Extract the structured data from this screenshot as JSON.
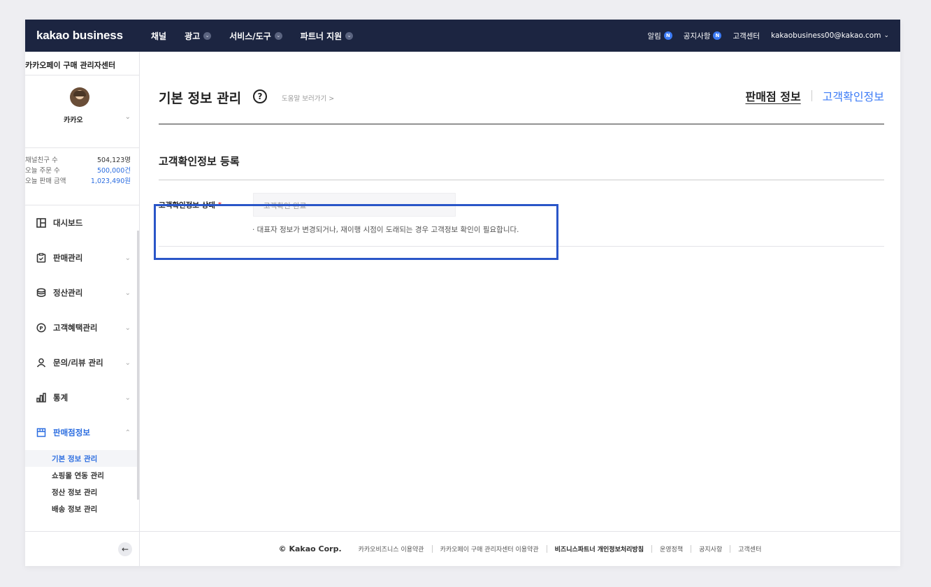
{
  "header": {
    "logo": "kakao business",
    "nav": [
      {
        "label": "채널",
        "dropdown": false
      },
      {
        "label": "광고",
        "dropdown": true
      },
      {
        "label": "서비스/도구",
        "dropdown": true
      },
      {
        "label": "파트너 지원",
        "dropdown": true
      }
    ],
    "alerts_label": "알림",
    "notice_label": "공지사항",
    "badge": "N",
    "support_label": "고객센터",
    "account": "kakaobusiness00@kakao.com"
  },
  "sidebar": {
    "title": "카카오페이 구매 관리자센터",
    "profile_name": "카카오",
    "stats": [
      {
        "label": "채널친구 수",
        "value": "504,123명",
        "highlight": false
      },
      {
        "label": "오늘 주문 수",
        "value": "500,000건",
        "highlight": true
      },
      {
        "label": "오늘 판매 금액",
        "value": "1,023,490원",
        "highlight": true
      }
    ],
    "menu": [
      {
        "label": "대시보드",
        "icon": "dashboard-icon",
        "expandable": false
      },
      {
        "label": "판매관리",
        "icon": "clipboard-icon",
        "expandable": true
      },
      {
        "label": "정산관리",
        "icon": "database-icon",
        "expandable": true
      },
      {
        "label": "고객혜택관리",
        "icon": "point-icon",
        "expandable": true
      },
      {
        "label": "문의/리뷰 관리",
        "icon": "person-icon",
        "expandable": true
      },
      {
        "label": "통계",
        "icon": "bar-chart-icon",
        "expandable": true
      },
      {
        "label": "판매점정보",
        "icon": "store-icon",
        "expandable": true,
        "expanded": true
      }
    ],
    "submenu": [
      {
        "label": "기본 정보 관리",
        "active": true
      },
      {
        "label": "쇼핑몰 연동 관리",
        "active": false
      },
      {
        "label": "정산 정보 관리",
        "active": false
      },
      {
        "label": "배송 정보 관리",
        "active": false
      }
    ]
  },
  "main": {
    "page_title": "기본 정보 관리",
    "help_link": "도움말 보러가기 >",
    "tabs": [
      {
        "label": "판매점 정보",
        "active": true
      },
      {
        "label": "고객확인정보",
        "active": false
      }
    ],
    "section_title": "고객확인정보 등록",
    "form": {
      "label": "고객확인정보 상태",
      "required_mark": "*",
      "status_value": "고객확인 완료",
      "note": "· 대표자 정보가 변경되거나, 재이행 시점이 도래되는 경우 고객정보 확인이 필요합니다."
    }
  },
  "footer": {
    "copyright": "© Kakao Corp.",
    "links": [
      {
        "label": "카카오비즈니스 이용약관",
        "bold": false
      },
      {
        "label": "카카오페이 구매 관리자센터 이용약관",
        "bold": false
      },
      {
        "label": "비즈니스파트너 개인정보처리방침",
        "bold": true
      },
      {
        "label": "운영정책",
        "bold": false
      },
      {
        "label": "공지사항",
        "bold": false
      },
      {
        "label": "고객센터",
        "bold": false
      }
    ]
  },
  "colors": {
    "topbar": "#1c2541",
    "accent": "#3c7bf6",
    "highlight_box": "#2a56c8",
    "required": "#e84040"
  }
}
